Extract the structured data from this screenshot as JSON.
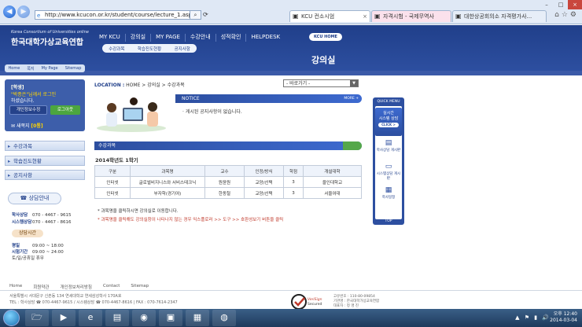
{
  "browser": {
    "url": "http://www.kcucon.or.kr/student/course/lecture_1.asp",
    "tabs": [
      {
        "label": "KCU 컨소시엄"
      },
      {
        "label": "자격시험 - 국제무역사"
      },
      {
        "label": "대한상공회의소 자격평가사..."
      }
    ]
  },
  "header": {
    "logo_en": "Korea Consortium of Universities online",
    "logo_ko": "한국대학가상교육연합",
    "nav": [
      "MY KCU",
      "강의실",
      "MY PAGE",
      "수강안내",
      "성적확인",
      "HELPDESK"
    ],
    "kcu_home": "KCU HOME",
    "subnav": [
      "수강과목",
      "학습진도현황",
      "공지사항"
    ],
    "page_title": "강의실"
  },
  "login_tabs": [
    "Home",
    "쪽지",
    "My Page",
    "Sitemap"
  ],
  "user": {
    "role": "[학생]",
    "name": "\"박종은\"님께서 로그인",
    "welcome": "하셨습니다.",
    "btn_info": "개인정보수정",
    "btn_logout": "로그아웃",
    "msg_prefix": "새쪽지 ",
    "msg_count": "[0통]"
  },
  "left_menu": [
    "수강과목",
    "학습진도현황",
    "공지사항"
  ],
  "counsel": {
    "title": "상담안내",
    "rows": [
      {
        "label": "학사상담",
        "value": "070 - 4467 - 9615"
      },
      {
        "label": "시스템상담",
        "value": "070 - 4467 - 8616"
      }
    ],
    "hours_title": "상담시간",
    "hours": [
      {
        "label": "평일",
        "value": "09:00 ~ 18:00"
      },
      {
        "label": "시험기간",
        "value": "09:00 ~ 24:00"
      }
    ],
    "holiday": "토/일/공휴일 휴무"
  },
  "location": {
    "prefix": "LOCATION :",
    "path": "HOME > 강의실 > 수강과목"
  },
  "jump_select": "- 바로가기 -",
  "notice": {
    "title": "NOTICE",
    "more": "MORE +",
    "text": "· 게시된 공지사항이 없습니다."
  },
  "course": {
    "section_title": "수강과목",
    "semester": "2014학년도 1학기",
    "headers": [
      "구분",
      "과목명",
      "교수",
      "인정/방식",
      "학점",
      "개설대학"
    ],
    "rows": [
      [
        "인터넷",
        "글로벌비지니스와 서비스테크닉",
        "원윤원",
        "교양/선택",
        "3",
        "을인대학교"
      ],
      [
        "인터넷",
        "부자학(경기여)",
        "한동철",
        "교양/선택",
        "3",
        "서울여대"
      ]
    ],
    "note1": "* 과목명을 클릭하시면 강의실로 이동합니다.",
    "note2": "* 과목명을 클릭해도 강의실창이 나타나지 않는 경우 익스플로러 >> 도구 >> 호환성보기 버튼을 클릭"
  },
  "quick_menu": {
    "title": "QUICK MENU",
    "chat_line1": "실시간",
    "chat_line2": "시스템 상담",
    "click": "CLICK >",
    "items": [
      "학사상담 게시판",
      "시스템상담 게시판",
      "학사일정"
    ],
    "top": "TOP"
  },
  "footer": {
    "nav": [
      "Home",
      "회원약관",
      "개인정보처리방침",
      "Contact",
      "Sitemap"
    ],
    "addr1": "서울특별시 서대문구 신촌동 134 연세대학교 연세삼성학사 170A호",
    "addr2": "TEL : 학사상담 ☎ 070-4467-9615 / 시스템상담 ☎ 070-4467-8616  |  FAX : 070-7614-2347",
    "verisign": "VeriSign Secured",
    "corp1": "고유번호 : 110-80-09854",
    "corp2": "기관명 : 한국대학가상교육연합",
    "corp3": "대표자 : 정 명 진"
  },
  "taskbar": {
    "time": "오후 12:40",
    "date": "2014-03-04"
  },
  "colors": {
    "primary": "#2d4fa0",
    "accent_green": "#4ca63f",
    "highlight": "#ffd400"
  }
}
